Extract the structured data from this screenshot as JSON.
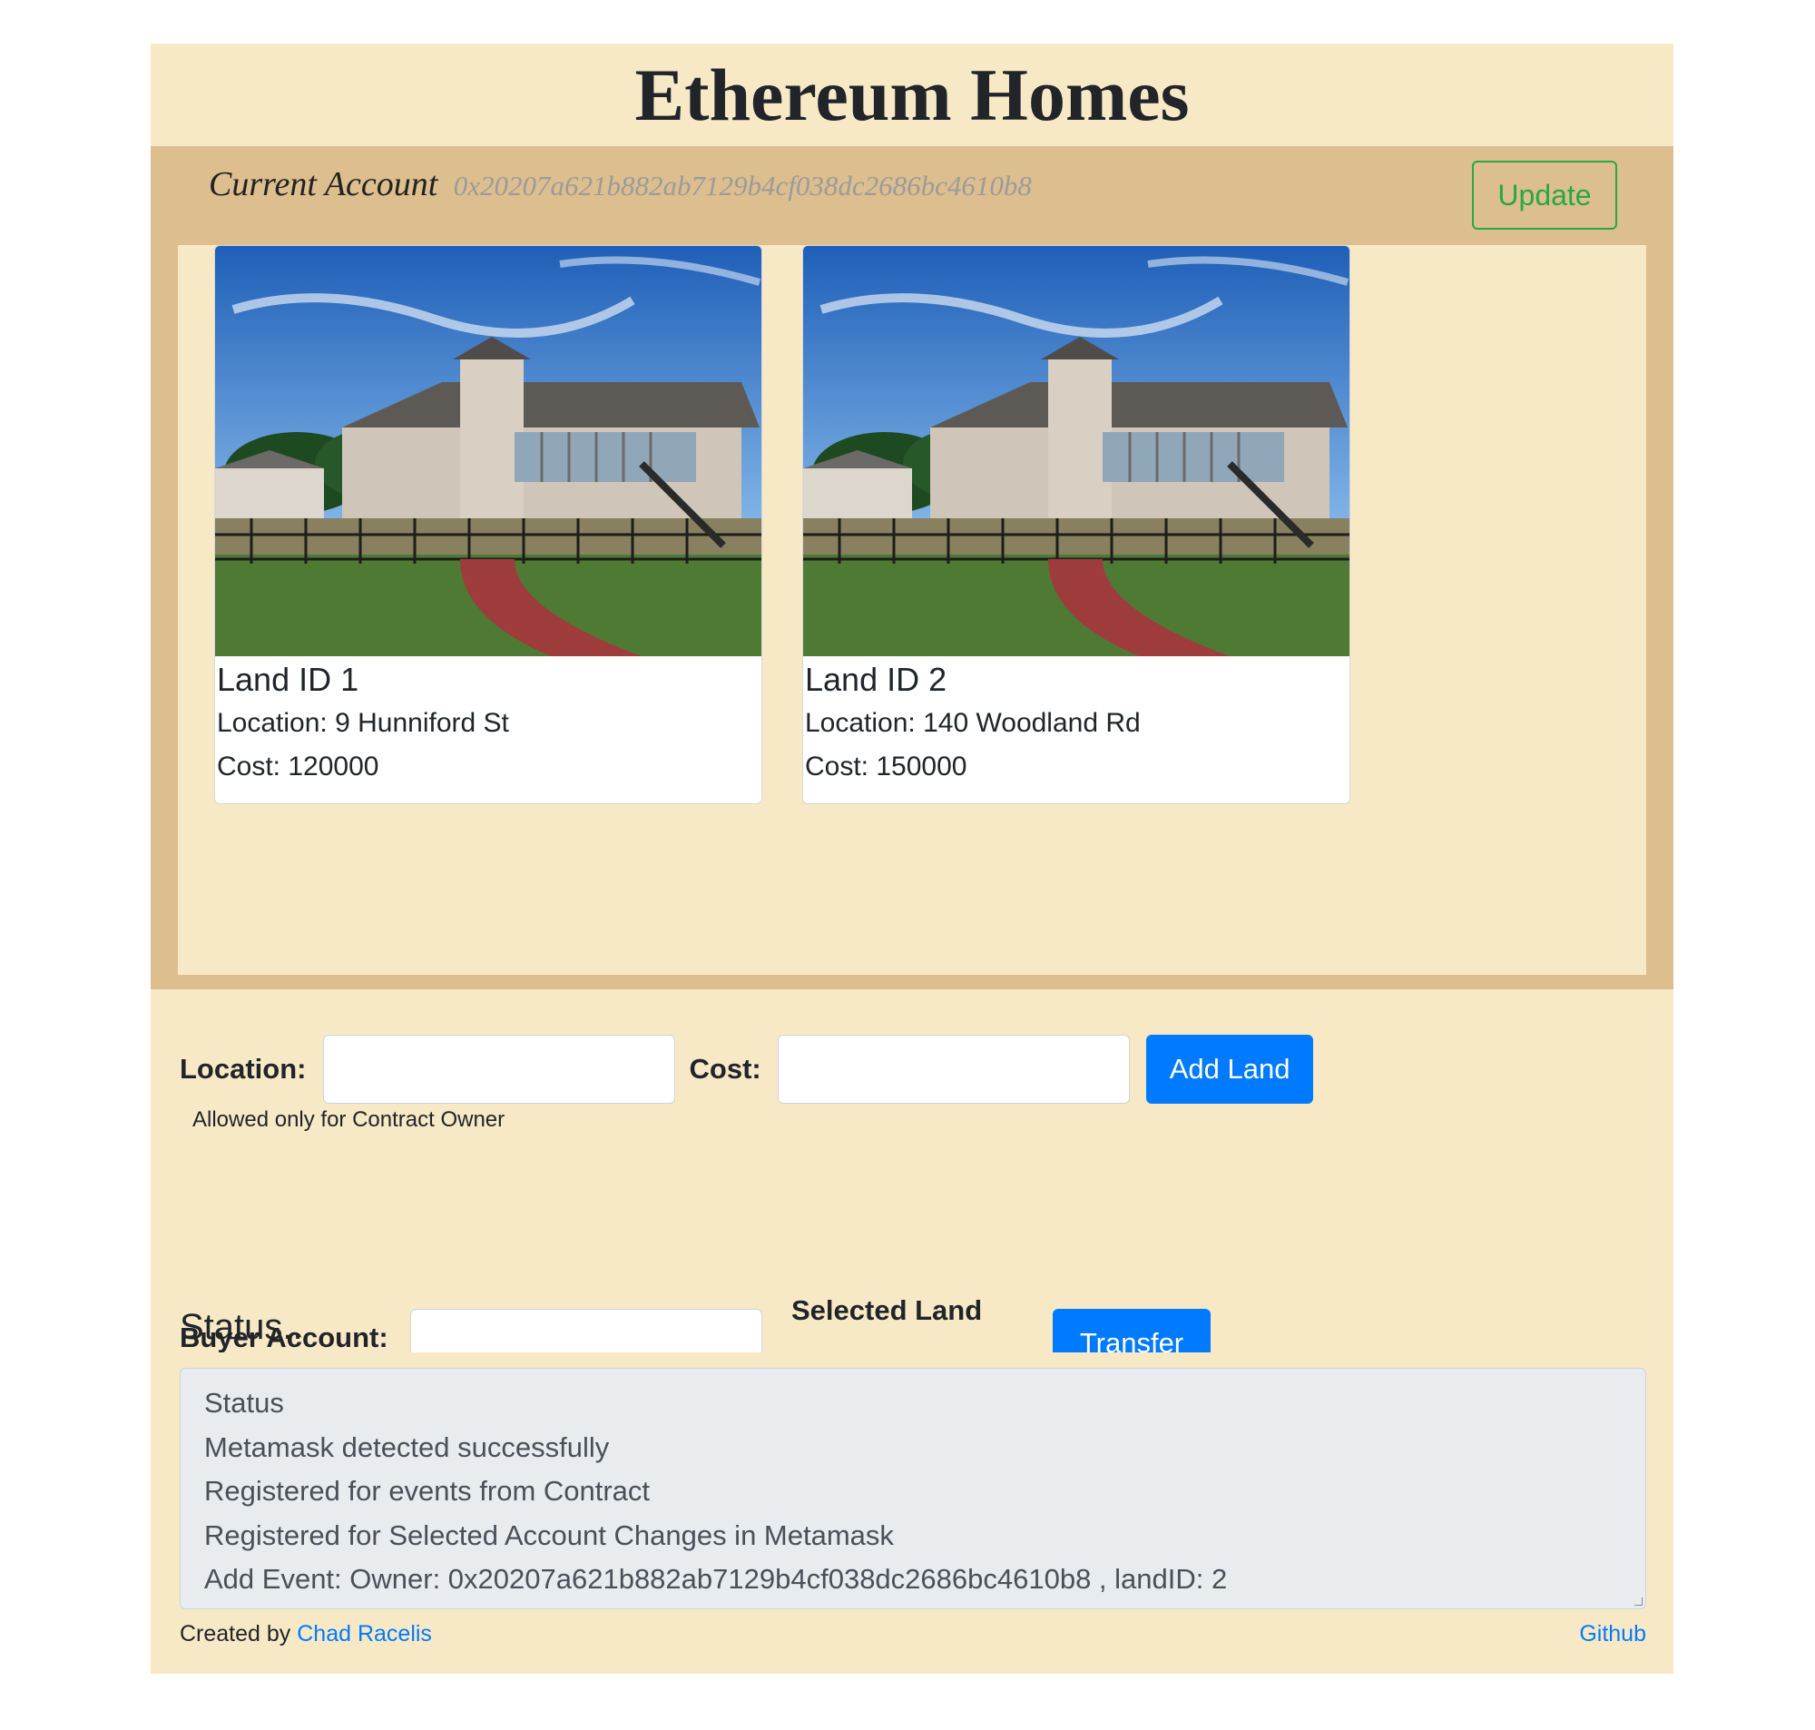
{
  "header": {
    "title": "Ethereum Homes"
  },
  "account": {
    "label": "Current Account",
    "address": "0x20207a621b882ab7129b4cf038dc2686bc4610b8",
    "update_label": "Update"
  },
  "lands": [
    {
      "title": "Land ID 1",
      "location": "Location: 9 Hunniford St",
      "cost": "Cost: 120000"
    },
    {
      "title": "Land ID 2",
      "location": "Location: 140 Woodland Rd",
      "cost": "Cost: 150000"
    }
  ],
  "add_form": {
    "location_label": "Location:",
    "cost_label": "Cost:",
    "location_value": "",
    "cost_value": "",
    "button_label": "Add Land",
    "hint": "Allowed only for Contract Owner"
  },
  "transfer_form": {
    "buyer_label": "Buyer Account:",
    "buyer_value": "",
    "selected_label": "Selected Land",
    "button_label": "Transfer"
  },
  "status": {
    "heading": "Status..",
    "lines": [
      "Status",
      "Metamask detected successfully",
      "Registered for events from Contract",
      "Registered for Selected Account Changes in Metamask",
      "Add Event: Owner: 0x20207a621b882ab7129b4cf038dc2686bc4610b8 , landID: 2"
    ]
  },
  "footer": {
    "created_by": "Created by",
    "author": "Chad Racelis",
    "github": "Github"
  },
  "colors": {
    "page_background": "#f8e9c6",
    "account_panel": "#ddbe8e",
    "primary": "#007bff",
    "success": "#28a745",
    "status_box": "#e9ecef"
  }
}
